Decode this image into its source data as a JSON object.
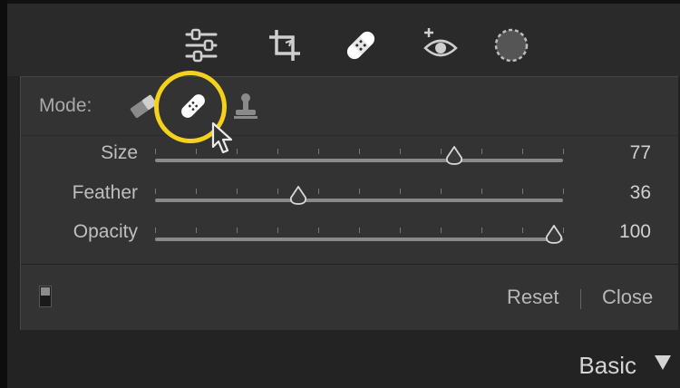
{
  "toolbar": {
    "tools": [
      {
        "name": "edit-sliders",
        "icon": "sliders-icon",
        "active": false
      },
      {
        "name": "crop",
        "icon": "crop-icon",
        "active": false
      },
      {
        "name": "healing",
        "icon": "bandage-icon",
        "active": true
      },
      {
        "name": "red-eye",
        "icon": "eye-plus-icon",
        "active": false
      },
      {
        "name": "masking",
        "icon": "dashed-circle-icon",
        "active": false
      }
    ]
  },
  "mode": {
    "label": "Mode:",
    "options": [
      {
        "name": "content-aware-remove",
        "icon": "eraser-icon",
        "selected": false
      },
      {
        "name": "heal",
        "icon": "bandage-icon",
        "selected": true
      },
      {
        "name": "clone",
        "icon": "stamp-icon",
        "selected": false
      }
    ]
  },
  "sliders": [
    {
      "label": "Size",
      "value": "77",
      "position": 0.75
    },
    {
      "label": "Feather",
      "value": "36",
      "position": 0.36
    },
    {
      "label": "Opacity",
      "value": "100",
      "position": 1.0
    }
  ],
  "footer": {
    "reset_label": "Reset",
    "close_label": "Close"
  },
  "panel_below": {
    "label": "Basic"
  },
  "colors": {
    "highlight": "#f4d21b",
    "panel_bg": "#333333",
    "toolbar_bg": "#2a2a2a"
  }
}
